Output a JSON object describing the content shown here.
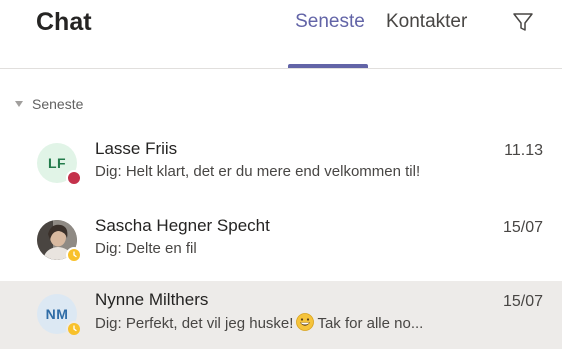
{
  "header": {
    "title": "Chat",
    "tabs": [
      {
        "label": "Seneste",
        "active": true
      },
      {
        "label": "Kontakter",
        "active": false
      }
    ],
    "filter_icon": "filter-icon"
  },
  "section": {
    "label": "Seneste",
    "icon": "chevron-down-icon"
  },
  "colors": {
    "accent": "#6264a7",
    "busy": "#c4314b",
    "away": "#f8c12b",
    "selected_bg": "#edebe9"
  },
  "chats": [
    {
      "initials": "LF",
      "name": "Lasse Friis",
      "time": "11.13",
      "preview": "Dig: Helt klart, det er du mere end velkommen til!",
      "presence": "busy"
    },
    {
      "initials": "",
      "avatar_type": "photo",
      "name": "Sascha Hegner Specht",
      "time": "15/07",
      "preview": "Dig: Delte en fil",
      "presence": "away"
    },
    {
      "initials": "NM",
      "name": "Nynne Milthers",
      "time": "15/07",
      "preview_before": "Dig: Perfekt, det vil jeg huske!",
      "preview_after": "Tak for alle no...",
      "preview_emoji": "grinning-emoji",
      "presence": "away",
      "selected": true
    }
  ]
}
